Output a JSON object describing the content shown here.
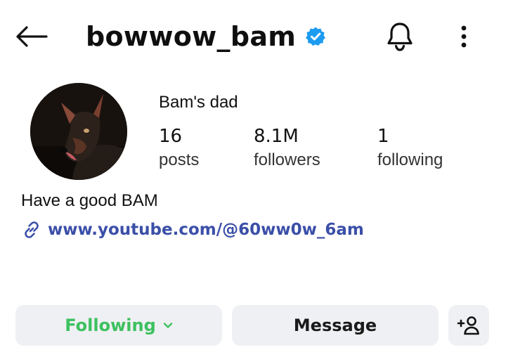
{
  "header": {
    "username": "bowwow_bam",
    "back_icon": "arrow-left-icon",
    "verified_icon": "verified-badge-icon",
    "bell_icon": "bell-icon",
    "more_icon": "more-vertical-icon"
  },
  "profile": {
    "display_name": "Bam's dad",
    "stats": {
      "posts": {
        "count": "16",
        "label": "posts"
      },
      "followers": {
        "count": "8.1M",
        "label": "followers"
      },
      "following": {
        "count": "1",
        "label": "following"
      }
    },
    "bio": "Have a good BAM",
    "link": "www.youtube.com/@60ww0w_6am"
  },
  "actions": {
    "following_label": "Following",
    "message_label": "Message",
    "add_user_icon": "add-user-icon"
  },
  "colors": {
    "verified": "#1d9bf0",
    "following_text": "#3cc160",
    "link_text": "#3b4fa8",
    "button_bg": "#eff0f3"
  }
}
